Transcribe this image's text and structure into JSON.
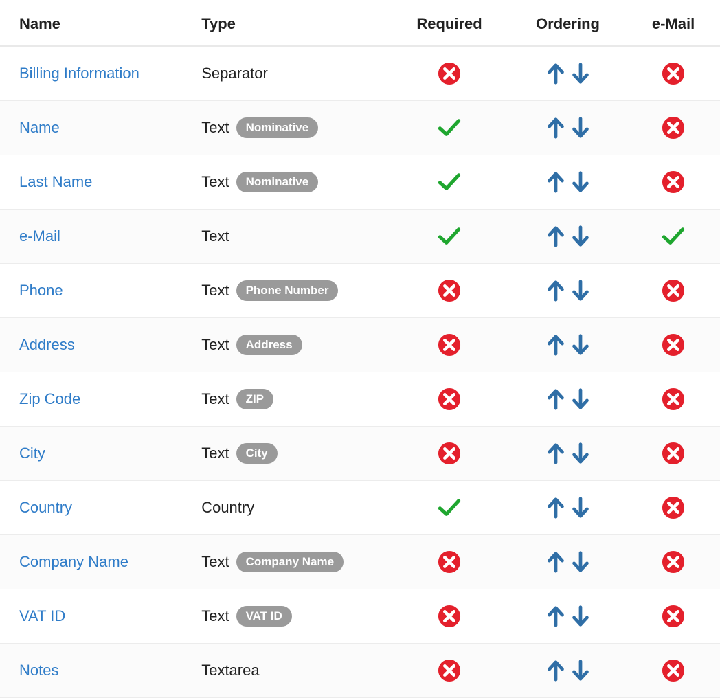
{
  "columns": {
    "name": "Name",
    "type": "Type",
    "required": "Required",
    "ordering": "Ordering",
    "email": "e-Mail"
  },
  "rows": [
    {
      "name": "Billing Information",
      "type": "Separator",
      "badge": null,
      "required": false,
      "email": false
    },
    {
      "name": "Name",
      "type": "Text",
      "badge": "Nominative",
      "required": true,
      "email": false
    },
    {
      "name": "Last Name",
      "type": "Text",
      "badge": "Nominative",
      "required": true,
      "email": false
    },
    {
      "name": "e-Mail",
      "type": "Text",
      "badge": null,
      "required": true,
      "email": true
    },
    {
      "name": "Phone",
      "type": "Text",
      "badge": "Phone Number",
      "required": false,
      "email": false
    },
    {
      "name": "Address",
      "type": "Text",
      "badge": "Address",
      "required": false,
      "email": false
    },
    {
      "name": "Zip Code",
      "type": "Text",
      "badge": "ZIP",
      "required": false,
      "email": false
    },
    {
      "name": "City",
      "type": "Text",
      "badge": "City",
      "required": false,
      "email": false
    },
    {
      "name": "Country",
      "type": "Country",
      "badge": null,
      "required": true,
      "email": false
    },
    {
      "name": "Company Name",
      "type": "Text",
      "badge": "Company Name",
      "required": false,
      "email": false
    },
    {
      "name": "VAT ID",
      "type": "Text",
      "badge": "VAT ID",
      "required": false,
      "email": false
    },
    {
      "name": "Notes",
      "type": "Textarea",
      "badge": null,
      "required": false,
      "email": false
    }
  ]
}
